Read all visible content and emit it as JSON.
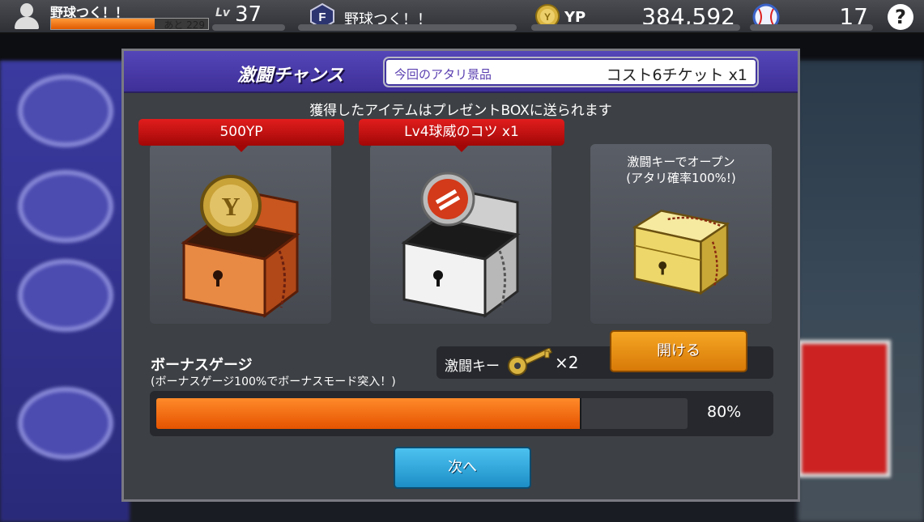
{
  "topbar": {
    "player_name": "野球つく！！",
    "exp_remaining": "あと 229",
    "exp_fill_fraction": 0.66,
    "level_label": "Lv",
    "level": "37",
    "team_name": "野球つく！！",
    "currency_label": "YP",
    "currency_value": "384,592",
    "ball_count": "17",
    "help_label": "?"
  },
  "modal": {
    "title": "激闘チャンス",
    "prize_label": "今回のアタリ景品",
    "prize_value": "コスト6チケット x1",
    "subtitle": "獲得したアイテムはプレゼントBOXに送られます",
    "cards": [
      {
        "banner": "500YP",
        "chest": "orange-chest-with-coin"
      },
      {
        "banner": "Lv4球威のコツ x1",
        "chest": "silver-chest-with-skill-badge"
      },
      {
        "note_line1": "激闘キーでオープン",
        "note_line2": "(アタリ確率100%!)",
        "chest": "gold-chest-closed"
      }
    ],
    "bonus_title": "ボーナスゲージ",
    "bonus_sub": "(ボーナスゲージ100%でボーナスモード突入！)",
    "key_label": "激闘キー",
    "key_count": "×2",
    "open_button": "開ける",
    "gauge_percent_value": 80,
    "gauge_percent_label": "80%",
    "next_button": "次へ"
  },
  "colors": {
    "header_purple": "#4a3cb0",
    "banner_red": "#c81010",
    "gauge_orange": "#f06a10",
    "open_button": "#f5a623",
    "next_button": "#2aa8e0"
  }
}
